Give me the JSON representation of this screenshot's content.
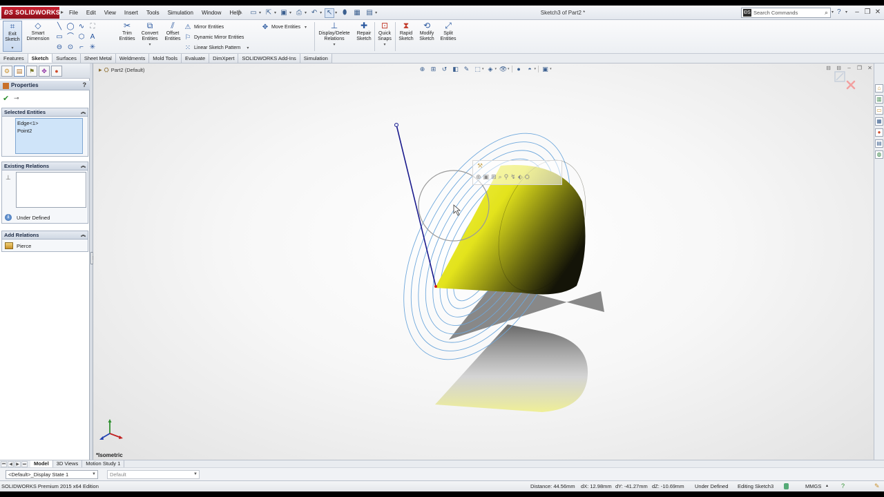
{
  "app": {
    "logo_text": "SOLIDWORKS",
    "document_title": "Sketch3 of Part2 *",
    "menu": [
      "File",
      "Edit",
      "View",
      "Insert",
      "Tools",
      "Simulation",
      "Window",
      "Help"
    ],
    "search": {
      "placeholder": "Search Commands"
    }
  },
  "command_manager": {
    "exit_sketch": "Exit Sketch",
    "smart_dimension": "Smart Dimension",
    "trim": "Trim Entities",
    "convert": "Convert Entities",
    "offset": "Offset Entities",
    "mirror": "Mirror Entities",
    "dynamic_mirror": "Dynamic Mirror Entities",
    "linear_pattern": "Linear Sketch Pattern",
    "move": "Move Entities",
    "display_delete": "Display/Delete Relations",
    "repair": "Repair Sketch",
    "quick_snaps": "Quick Snaps",
    "rapid": "Rapid Sketch",
    "modify": "Modify Sketch",
    "split": "Split Entities"
  },
  "tabs": [
    "Features",
    "Sketch",
    "Surfaces",
    "Sheet Metal",
    "Weldments",
    "Mold Tools",
    "Evaluate",
    "DimXpert",
    "SOLIDWORKS Add-Ins",
    "Simulation"
  ],
  "active_tab": "Sketch",
  "property_manager": {
    "title": "Properties",
    "selected_entities": {
      "title": "Selected Entities",
      "items": [
        "Edge<1>",
        "Point2"
      ]
    },
    "existing_relations": {
      "title": "Existing Relations",
      "status": "Under Defined"
    },
    "add_relations": {
      "title": "Add Relations",
      "items": [
        "Pierce"
      ]
    }
  },
  "viewport": {
    "tree_node": "Part2  (Default)",
    "view_orientation": "*Isometric",
    "cone_color": "#e6e61a",
    "sketch_color": "#5b9bd5",
    "line_color": "#1a1a8c"
  },
  "bottom_tabs": [
    "Model",
    "3D Views",
    "Motion Study 1"
  ],
  "active_bottom_tab": "Model",
  "display_state": "<Default>_Display State 1",
  "config": "Default",
  "status": {
    "edition": "SOLIDWORKS Premium 2015 x64 Edition",
    "distance": "Distance: 44.56mm",
    "dx": "dX: 12.98mm",
    "dy": "dY: -41.27mm",
    "dz": "dZ: -10.69mm",
    "defined": "Under Defined",
    "editing": "Editing Sketch3",
    "units": "MMGS"
  }
}
